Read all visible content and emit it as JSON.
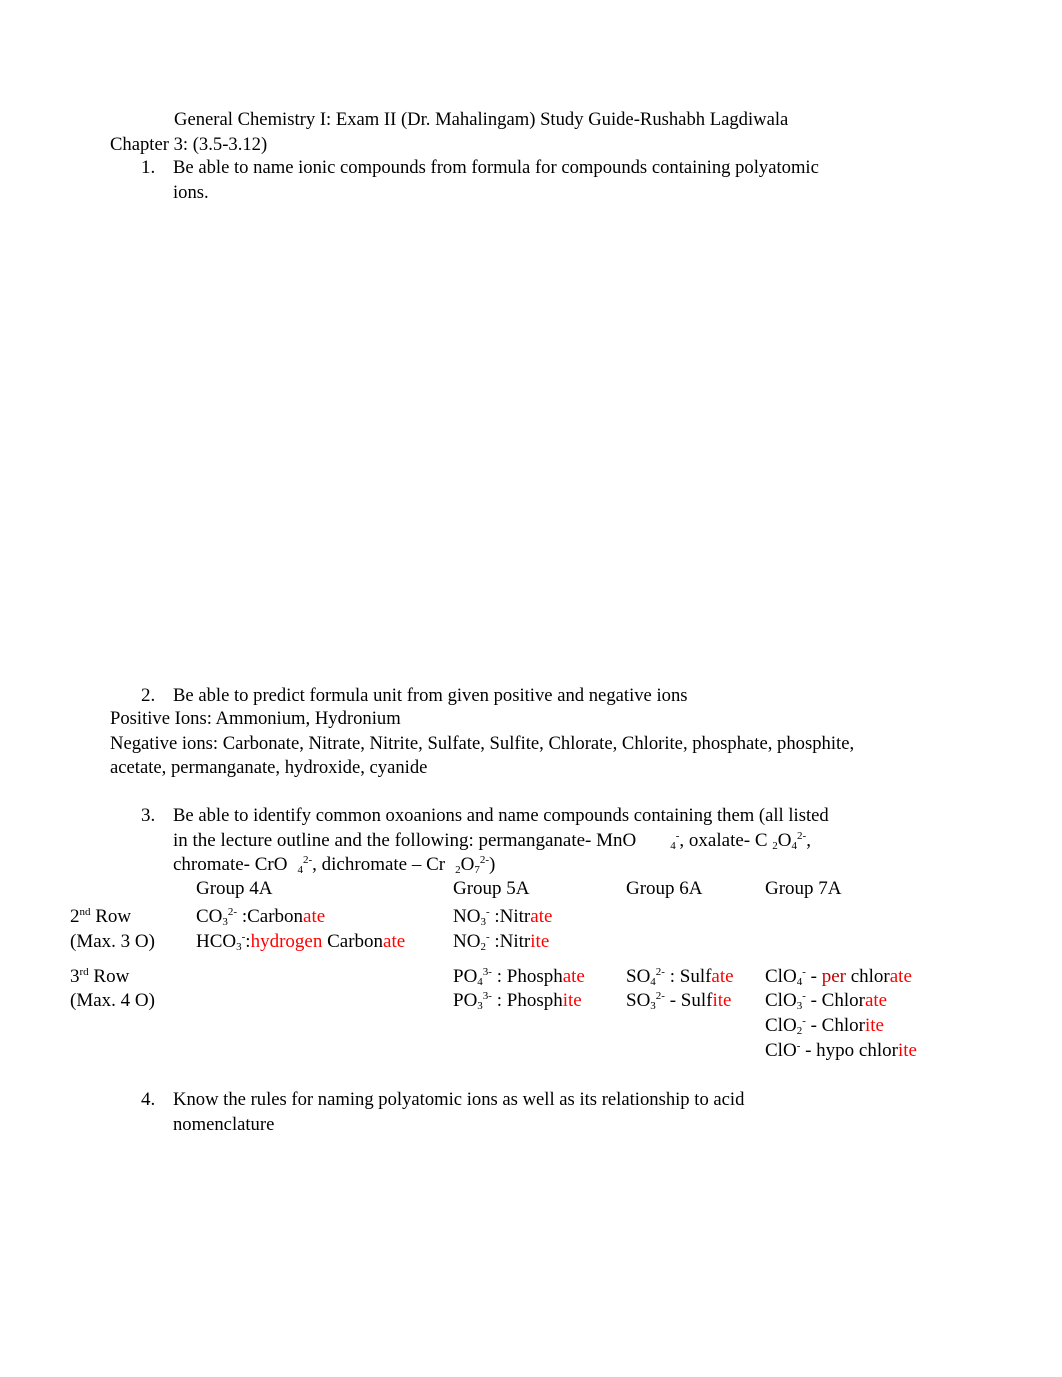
{
  "header": {
    "title": "General Chemistry I: Exam II (Dr. Mahalingam) Study Guide-Rushabh Lagdiwala",
    "chapter": "Chapter 3: (3.5-3.12)"
  },
  "items": [
    {
      "num": "1.",
      "line1": "Be able to name ionic compounds from formula for compounds containing polyatomic",
      "line2": "ions."
    },
    {
      "num": "2.",
      "line1": "Be able to predict formula unit from given positive and negative ions"
    },
    {
      "num": "3.",
      "line1": "Be able to identify common oxoanions and name compounds containing them (all listed"
    },
    {
      "num": "4.",
      "line1": "Know the rules for naming polyatomic ions as well as its relationship to acid",
      "line2": "nomenclature"
    }
  ],
  "ions": {
    "positive": "Positive Ions: Ammonium, Hydronium",
    "negative_line1": "Negative ions: Carbonate, Nitrate, Nitrite, Sulfate, Sulfite, Chlorate, Chlorite, phosphate, phosphite,",
    "negative_line2": "acetate, permanganate, hydroxide, cyanide"
  },
  "item3_text": {
    "l2a": "in the lecture outline and the following: permanganate- MnO",
    "sub4": "4",
    "sup_minus": "-",
    "l2b": ", oxalate- C ",
    "sub2": "2",
    "o": "O",
    "sup_2minus": "2-",
    "comma": ",",
    "l3a": "chromate- CrO",
    "l3b": ", dichromate – Cr",
    "sub7": "7",
    "close": ")"
  },
  "table": {
    "headers": [
      "Group 4A",
      "Group 5A",
      "Group 6A",
      "Group 7A"
    ],
    "row2_label": {
      "ord": "2",
      "sup": "nd",
      "word": " Row",
      "max": "(Max. 3 O)"
    },
    "row3_label": {
      "ord": "3",
      "sup": "rd",
      "word": " Row",
      "max": "(Max. 4 O)"
    },
    "entries": {
      "co3": {
        "f": "CO",
        "sub": "3",
        "sup": "2-",
        "sep": " :Carbon",
        "end": "ate"
      },
      "hco3": {
        "f": "HCO",
        "sub": "3",
        "sup": "-",
        "sep": ":",
        "red1": "hydrogen",
        "mid": " Carbon",
        "end": "ate"
      },
      "no3": {
        "f": "NO",
        "sub": "3",
        "sup": "-",
        "sep": " :Nitr",
        "end": "ate"
      },
      "no2": {
        "f": "NO",
        "sub": "2",
        "sup": "-",
        "sep": " :Nitr",
        "end": "ite"
      },
      "po4": {
        "f": "PO",
        "sub": "4",
        "sup": "3-",
        "sep": " : Phosph",
        "end": "ate"
      },
      "po3": {
        "f": "PO",
        "sub": "3",
        "sup": "3-",
        "sep": " : Phosph",
        "end": "ite"
      },
      "so4": {
        "f": "SO",
        "sub": "4",
        "sup": "2-",
        "sep": " : Sulf",
        "end": "ate"
      },
      "so3": {
        "f": "SO",
        "sub": "3",
        "sup": "2-",
        "sep": " - Sulf",
        "end": "ite"
      },
      "clo4": {
        "f": "ClO",
        "sub": "4",
        "sup": "-",
        "sep": " - ",
        "red1": "per",
        "mid": " chlor",
        "end": "ate"
      },
      "clo3": {
        "f": "ClO",
        "sub": "3",
        "sup": "-",
        "sep": " - Chlor",
        "end": "ate"
      },
      "clo2": {
        "f": "ClO",
        "sub": "2",
        "sup": "-",
        "sep": " - Chlor",
        "end": "ite"
      },
      "clo": {
        "f": "ClO",
        "sup": "-",
        "sep": " - hypo chlor",
        "end": "ite"
      }
    }
  },
  "colors": {
    "suffix_red": "#ff0000",
    "prefix_darkred": "#c00000"
  }
}
